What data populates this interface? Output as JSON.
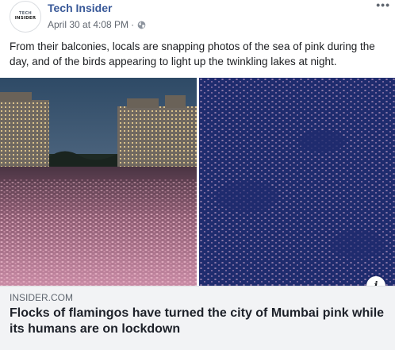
{
  "header": {
    "page_name": "Tech Insider",
    "avatar_line1": "TECH",
    "avatar_line2": "INSIDER",
    "timestamp": "April 30 at 4:08 PM",
    "separator": "·",
    "privacy_icon": "globe-icon",
    "more_label": "•••"
  },
  "post": {
    "text": "From their balconies, locals are snapping photos of the sea of pink during the day, and of the birds appearing to light up the twinkling lakes at night."
  },
  "media": {
    "left_image": "flamingos-lake-dusk-photo",
    "right_image": "flamingos-aerial-night-photo",
    "info_label": "i"
  },
  "link": {
    "domain": "INSIDER.COM",
    "headline": "Flocks of flamingos have turned the city of Mumbai pink while its humans are on lockdown"
  },
  "colors": {
    "page_name": "#385898",
    "meta_text": "#616770",
    "link_box_bg": "#f2f3f5",
    "lake_pink": "#d9a0b4",
    "night_blue": "#1f2c6e"
  }
}
